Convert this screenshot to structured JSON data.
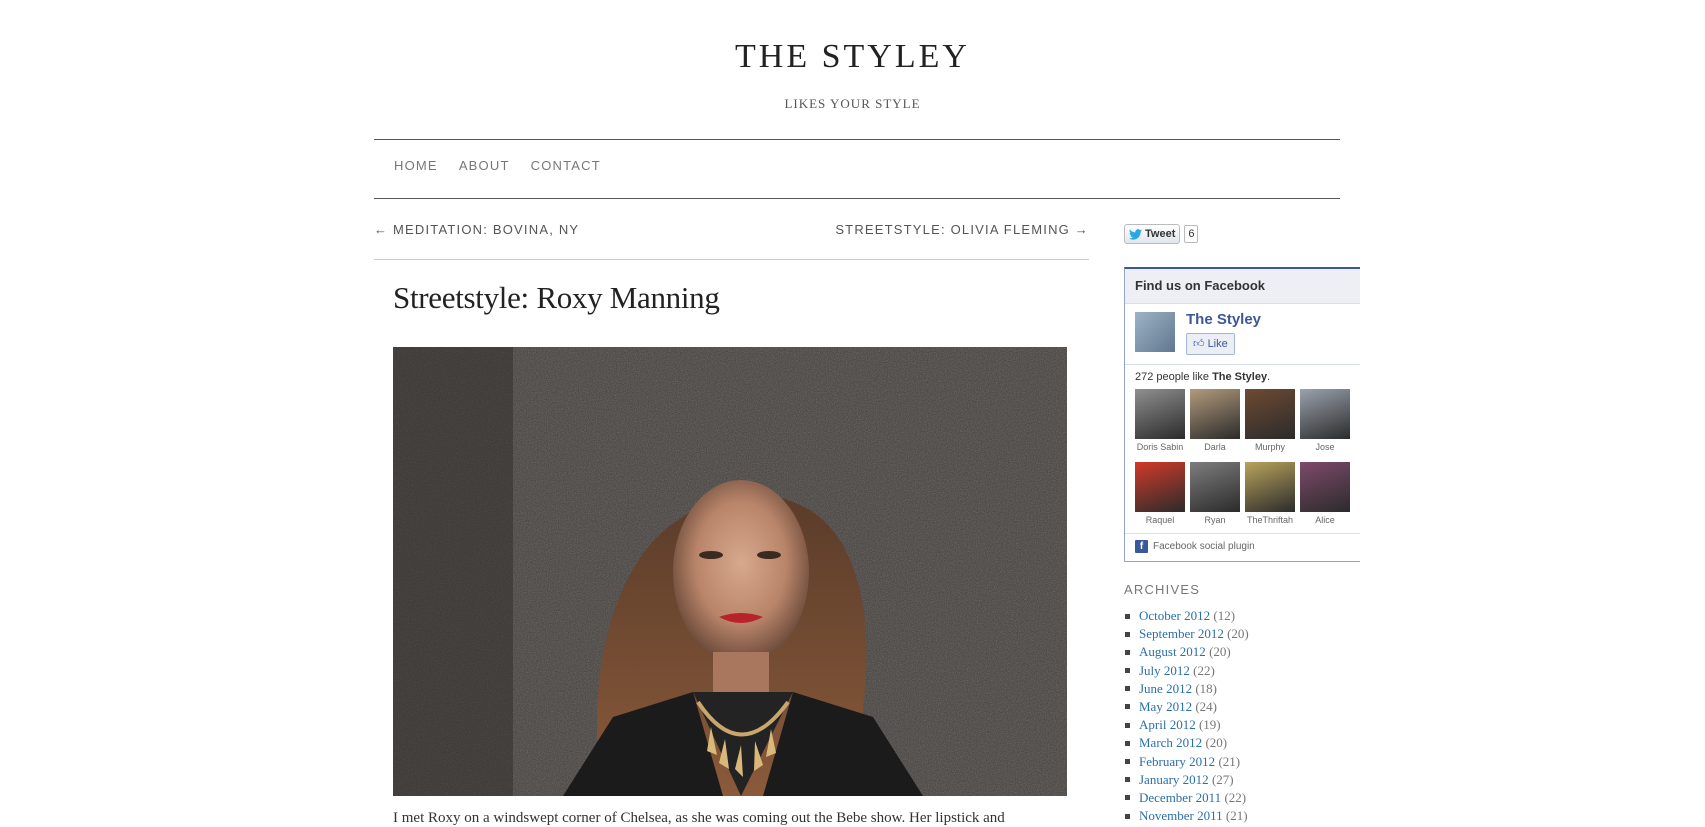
{
  "site": {
    "title": "THE STYLEY",
    "tagline": "LIKES YOUR STYLE"
  },
  "nav": {
    "items": [
      {
        "label": "HOME"
      },
      {
        "label": "ABOUT"
      },
      {
        "label": "CONTACT"
      }
    ]
  },
  "post_nav": {
    "prev": "← MEDITATION: BOVINA, NY",
    "next": "STREETSTYLE: OLIVIA FLEMING →"
  },
  "post": {
    "title": "Streetstyle: Roxy Manning",
    "intro": "I met Roxy on a windswept corner of Chelsea, as she was coming out the Bebe show. Her lipstick and"
  },
  "tweet": {
    "label": "Tweet",
    "count": "6"
  },
  "facebook": {
    "header": "Find us on Facebook",
    "page_name": "The Styley",
    "like_label": "Like",
    "count_prefix": "272 people like ",
    "count_page": "The Styley",
    "count_suffix": ".",
    "fans": [
      {
        "name": "Doris Sabin",
        "color": "#8f8f8f"
      },
      {
        "name": "Darla",
        "color": "#b39a7c"
      },
      {
        "name": "Murphy",
        "color": "#6e4a33"
      },
      {
        "name": "Jose",
        "color": "#9aa2ad"
      },
      {
        "name": "Raquel",
        "color": "#d13a2a"
      },
      {
        "name": "Ryan",
        "color": "#7d7d7d"
      },
      {
        "name": "TheThriftah",
        "color": "#b9a35c"
      },
      {
        "name": "Alice",
        "color": "#7e4a6b"
      }
    ],
    "footer": "Facebook social plugin"
  },
  "archives": {
    "heading": "ARCHIVES",
    "items": [
      {
        "month": "October 2012",
        "count": "(12)"
      },
      {
        "month": "September 2012",
        "count": "(20)"
      },
      {
        "month": "August 2012",
        "count": "(20)"
      },
      {
        "month": "July 2012",
        "count": "(22)"
      },
      {
        "month": "June 2012",
        "count": "(18)"
      },
      {
        "month": "May 2012",
        "count": "(24)"
      },
      {
        "month": "April 2012",
        "count": "(19)"
      },
      {
        "month": "March 2012",
        "count": "(20)"
      },
      {
        "month": "February 2012",
        "count": "(21)"
      },
      {
        "month": "January 2012",
        "count": "(27)"
      },
      {
        "month": "December 2011",
        "count": "(22)"
      },
      {
        "month": "November 2011",
        "count": "(21)"
      }
    ]
  },
  "colors": {
    "link": "#2a6fa8",
    "facebook": "#3b5998"
  }
}
